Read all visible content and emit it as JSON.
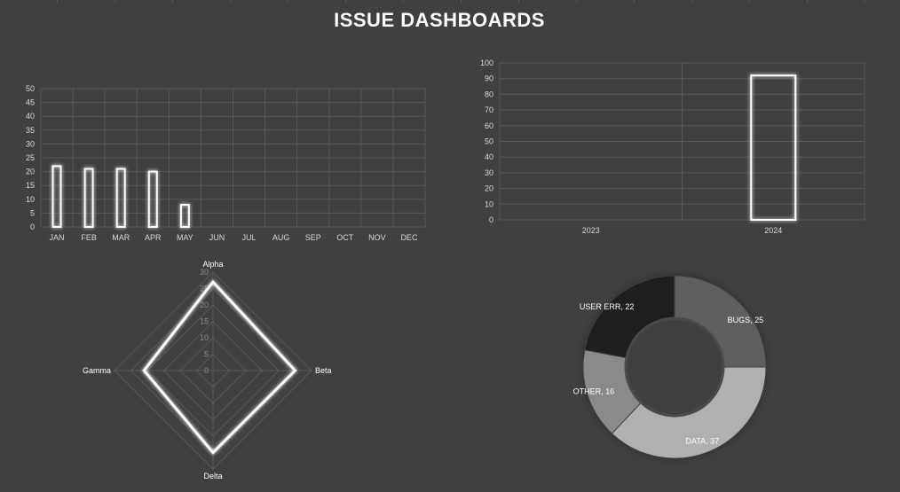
{
  "dashboard": {
    "title": "ISSUE DASHBOARDS"
  },
  "colors": {
    "background": "#404040",
    "grid": "#595959",
    "bar_stroke": "#ffffff",
    "text": "#d9d9d9"
  },
  "chart_data": [
    {
      "id": "monthly",
      "type": "bar",
      "categories": [
        "JAN",
        "FEB",
        "MAR",
        "APR",
        "MAY",
        "JUN",
        "JUL",
        "AUG",
        "SEP",
        "OCT",
        "NOV",
        "DEC"
      ],
      "values": [
        22,
        21,
        21,
        20,
        8,
        0,
        0,
        0,
        0,
        0,
        0,
        0
      ],
      "ylim": [
        0,
        50
      ],
      "yticks": [
        0,
        5,
        10,
        15,
        20,
        25,
        30,
        35,
        40,
        45,
        50
      ],
      "grid": true
    },
    {
      "id": "yearly",
      "type": "bar",
      "categories": [
        "2023",
        "2024"
      ],
      "values": [
        0,
        92
      ],
      "ylim": [
        0,
        100
      ],
      "yticks": [
        0,
        10,
        20,
        30,
        40,
        50,
        60,
        70,
        80,
        90,
        100
      ],
      "grid": true
    },
    {
      "id": "radar",
      "type": "radar",
      "categories": [
        "Alpha",
        "Beta",
        "Delta",
        "Gamma"
      ],
      "values": [
        27,
        25,
        25,
        21
      ],
      "rlim": [
        0,
        30
      ],
      "rticks": [
        0,
        5,
        10,
        15,
        20,
        25,
        30
      ],
      "grid": true
    },
    {
      "id": "issues",
      "type": "pie",
      "style": "doughnut",
      "slices": [
        {
          "label": "BUGS",
          "value": 25,
          "color": "#5f5f5f",
          "text": "BUGS, 25"
        },
        {
          "label": "DATA",
          "value": 37,
          "color": "#b0b0b0",
          "text": "DATA, 37"
        },
        {
          "label": "OTHER",
          "value": 16,
          "color": "#8a8a8a",
          "text": "OTHER, 16"
        },
        {
          "label": "USER ERR",
          "value": 22,
          "color": "#1e1e1e",
          "text": "USER ERR, 22"
        }
      ]
    }
  ]
}
